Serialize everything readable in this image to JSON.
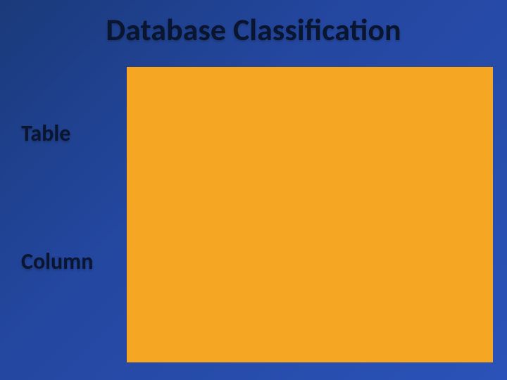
{
  "slide": {
    "title": "Database Classification",
    "labels": {
      "table": "Table",
      "column": "Column"
    }
  }
}
